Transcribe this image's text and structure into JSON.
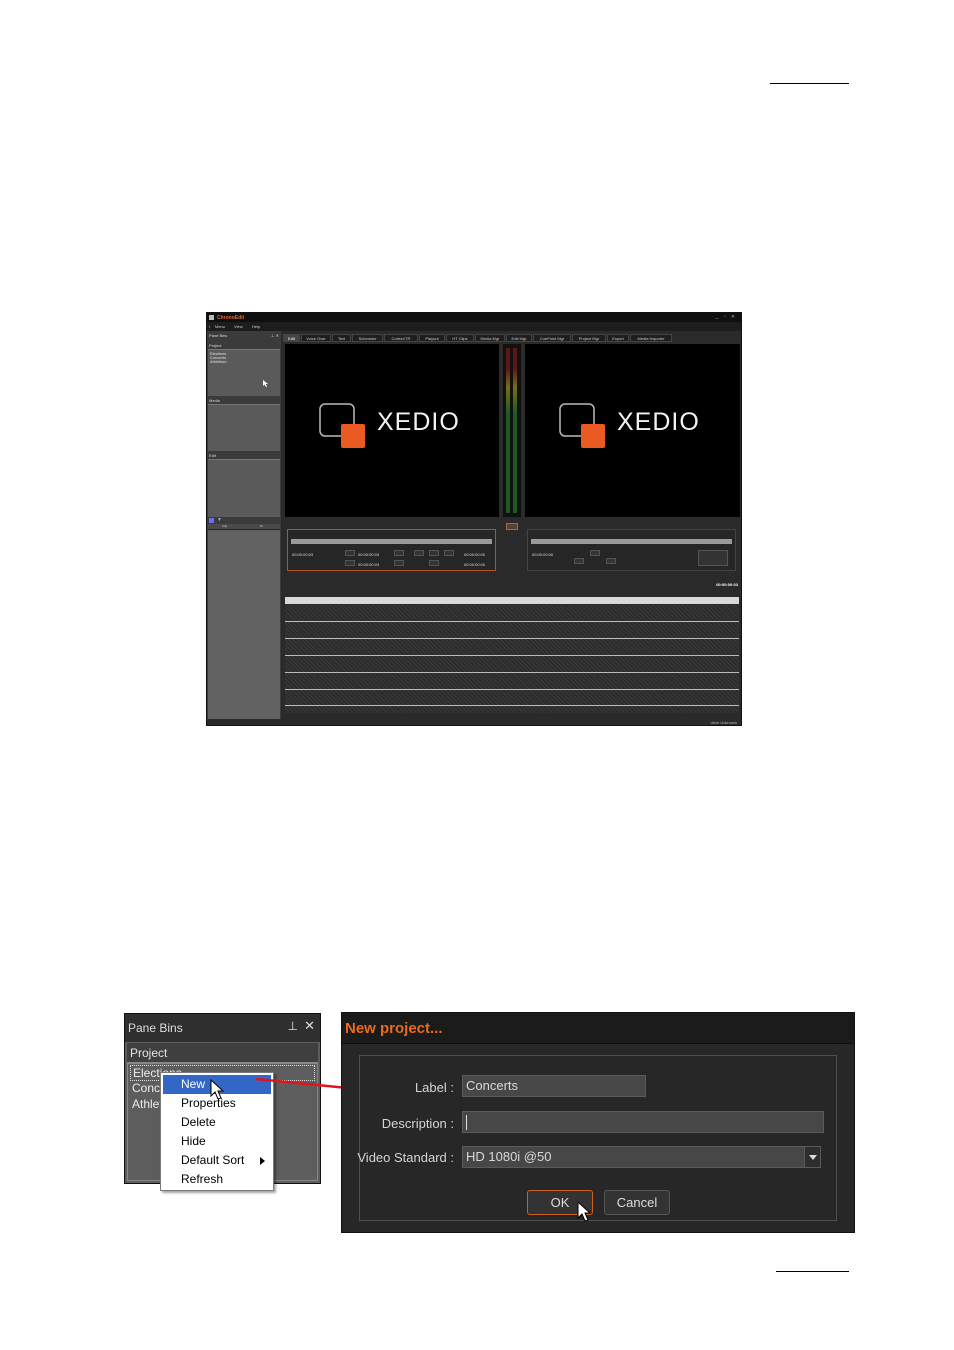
{
  "app": {
    "title": "ChronoEdit",
    "menu": [
      "Menu",
      "View",
      "Help"
    ],
    "left_header": "Pane Bins",
    "bins": [
      {
        "label": "Project",
        "items": [
          "Elections",
          "Concerts",
          "Athletism"
        ]
      },
      {
        "label": "Media",
        "items": []
      },
      {
        "label": "Edit",
        "items": []
      }
    ],
    "list_columns": [
      "Clip",
      "Dr"
    ],
    "tabs": [
      "Edit",
      "Voice Over",
      "Text",
      "Scheduler",
      "CorbaVTR",
      "Playout",
      "HT Clips",
      "Media Mgr",
      "Edit Mgr",
      "CuePoint Mgr",
      "Project Mgr",
      "Export",
      "Media Importer"
    ],
    "viewer_logo": "XEDIO",
    "left_controls": {
      "tc_a": "00:00:00:03",
      "tc_in": "00:00:00:03",
      "tc_out": "00:00:00:03",
      "tc_dur": "00:00:00:00",
      "tc_end": "00:00:00:00"
    },
    "right_controls": {
      "tc_a": "00:00:00:00"
    },
    "main_timecode": "00:00:00:03",
    "status": "drive Unknown"
  },
  "pane": {
    "title": "Pane Bins",
    "section": "Project",
    "items": [
      "Elections",
      "Concerts",
      "Athletism"
    ]
  },
  "context_menu": [
    "New",
    "Properties",
    "Delete",
    "Hide",
    "Default Sort",
    "Refresh"
  ],
  "dialog": {
    "title": "New project...",
    "label_caption": "Label :",
    "label_value": "Concerts",
    "description_caption": "Description :",
    "description_value": "",
    "video_caption": "Video Standard :",
    "video_value": "HD 1080i @50",
    "ok": "OK",
    "cancel": "Cancel"
  },
  "colors": {
    "accent": "#ec6a1d",
    "highlight": "#3267c6",
    "arrow": "#e0151b"
  }
}
